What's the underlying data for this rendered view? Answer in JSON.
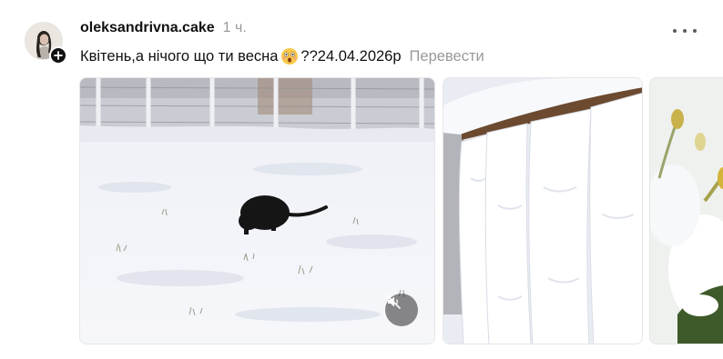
{
  "post": {
    "username": "oleksandrivna.cake",
    "timestamp": "1 ч.",
    "caption_before_emoji": "Квітень,а нічого що ти весна",
    "caption_after_emoji": "??24.04.2026р",
    "translate_label": "Перевести",
    "emoji_icon": "astonished-face-emoji",
    "more_icon": "more-horizontal-icon",
    "follow_icon": "plus-icon"
  },
  "media": [
    {
      "kind": "video",
      "description_icon": "snowy-yard-photo",
      "muted": true,
      "mute_icon": "speaker-muted-icon"
    },
    {
      "kind": "photo",
      "description_icon": "snowy-fence-photo"
    },
    {
      "kind": "photo",
      "description_icon": "snowy-flower-photo"
    }
  ],
  "colors": {
    "text": "#101010",
    "secondary": "#999999",
    "snow": "#f4f6fb",
    "badge": "#101010"
  }
}
